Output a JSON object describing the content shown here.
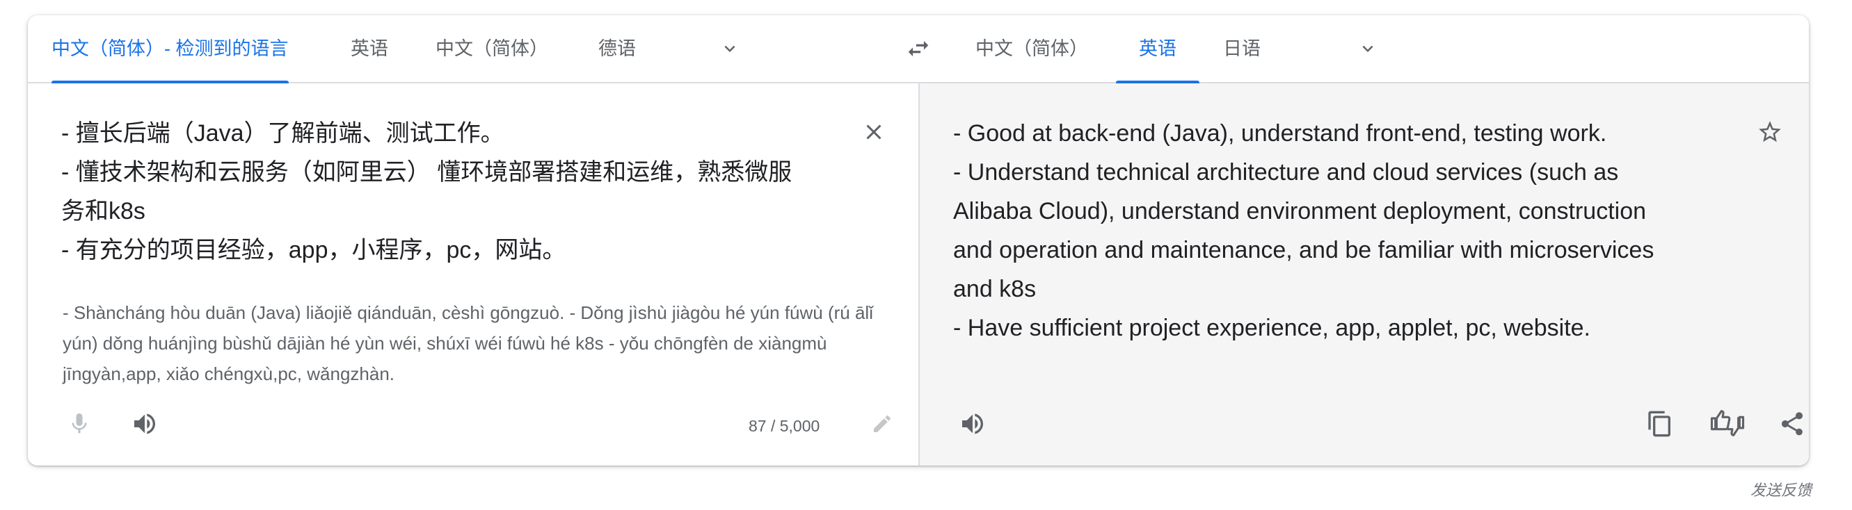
{
  "source_langs": {
    "detected": "中文（简体）- 检测到的语言",
    "tab2": "英语",
    "tab3": "中文（简体）",
    "tab4": "德语"
  },
  "target_langs": {
    "tab1": "中文（简体）",
    "tab2": "英语",
    "tab3": "日语"
  },
  "source": {
    "lines": [
      "- 擅长后端（Java）了解前端、测试工作。",
      "- 懂技术架构和云服务（如阿里云） 懂环境部署搭建和运维，熟悉微服",
      "务和k8s",
      "- 有充分的项目经验，app，小程序，pc，网站。"
    ],
    "transliteration": "- Shàncháng hòu duān (Java) liǎojiě qiánduān, cèshì gōngzuò. - Dǒng jìshù jiàgòu hé yún fúwù (rú ālǐ yún) dǒng huánjìng bùshǔ dājiàn hé yùn wéi, shúxī wéi fúwù hé k8s - yǒu chōngfèn de xiàngmù jīngyàn,app, xiǎo chéngxù,pc, wǎngzhàn.",
    "char_count": "87 / 5,000"
  },
  "target": {
    "lines": [
      "- Good at back-end (Java), understand front-end, testing work.",
      "- Understand technical architecture and cloud services (such as",
      "Alibaba Cloud), understand environment deployment, construction",
      "and operation and maintenance, and be familiar with microservices",
      "and k8s",
      "- Have sufficient project experience, app, applet, pc, website."
    ]
  },
  "footer": {
    "feedback": "发送反馈"
  },
  "colors": {
    "accent": "#1a73e8",
    "text": "#202124",
    "muted": "#5f6368",
    "target_bg": "#f5f5f5"
  },
  "icons": [
    "chevron-down-icon",
    "swap-icon",
    "close-icon",
    "microphone-icon",
    "speaker-icon",
    "edit-icon",
    "star-icon",
    "copy-icon",
    "rate-icon",
    "share-icon"
  ]
}
